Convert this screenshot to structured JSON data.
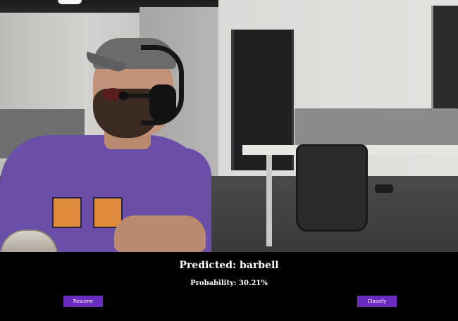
{
  "prediction": {
    "title": "Predicted: barbell",
    "probability": "Probability: 30.21%"
  },
  "controls": {
    "resume_label": "Resume",
    "classify_label": "Classify"
  },
  "colors": {
    "background": "#000000",
    "button_bg": "#6a2bbf",
    "text": "#ffffff"
  }
}
